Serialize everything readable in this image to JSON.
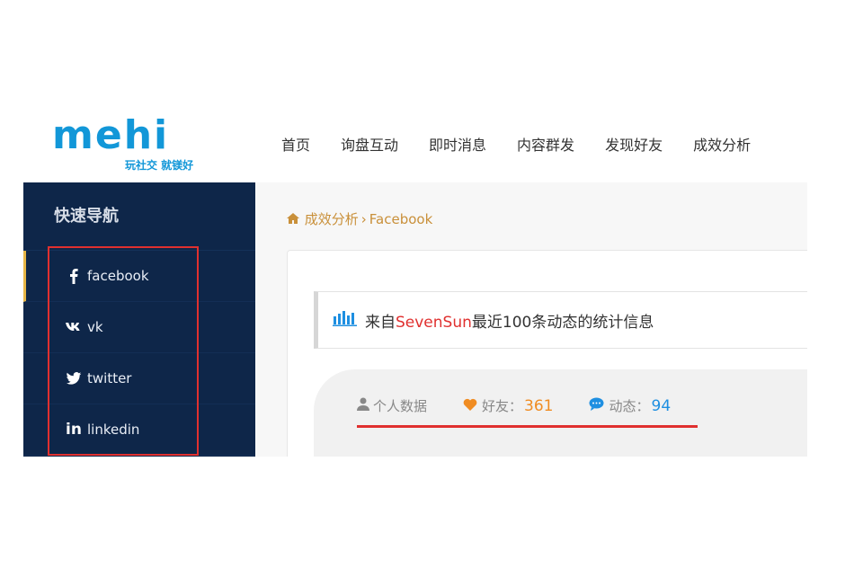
{
  "brand": {
    "logo_text": "mehi",
    "tagline": "玩社交 就镁好",
    "color": "#1297d8"
  },
  "topnav": {
    "items": [
      "首页",
      "询盘互动",
      "即时消息",
      "内容群发",
      "发现好友",
      "成效分析"
    ]
  },
  "sidebar": {
    "title": "快速导航",
    "items": [
      {
        "icon": "facebook-icon",
        "glyph": "f",
        "label": "facebook"
      },
      {
        "icon": "vk-icon",
        "glyph": "vk",
        "label": "vk"
      },
      {
        "icon": "twitter-icon",
        "glyph": "bird",
        "label": "twitter"
      },
      {
        "icon": "linkedin-icon",
        "glyph": "in",
        "label": "linkedin"
      }
    ]
  },
  "breadcrumb": {
    "section": "成效分析",
    "page": "Facebook"
  },
  "info_bar": {
    "prefix": "来自",
    "account": "SevenSun",
    "suffix": "最近100条动态的统计信息"
  },
  "stats": {
    "personal_label": "个人数据",
    "friends_label": "好友：",
    "friends_value": "361",
    "posts_label": "动态：",
    "posts_value": "94"
  },
  "colors": {
    "sidebar_bg": "#0e2649",
    "highlight_red": "#e0302f",
    "breadcrumb": "#c9903a",
    "accent_orange": "#f08c22",
    "accent_blue": "#1e8fe1"
  }
}
